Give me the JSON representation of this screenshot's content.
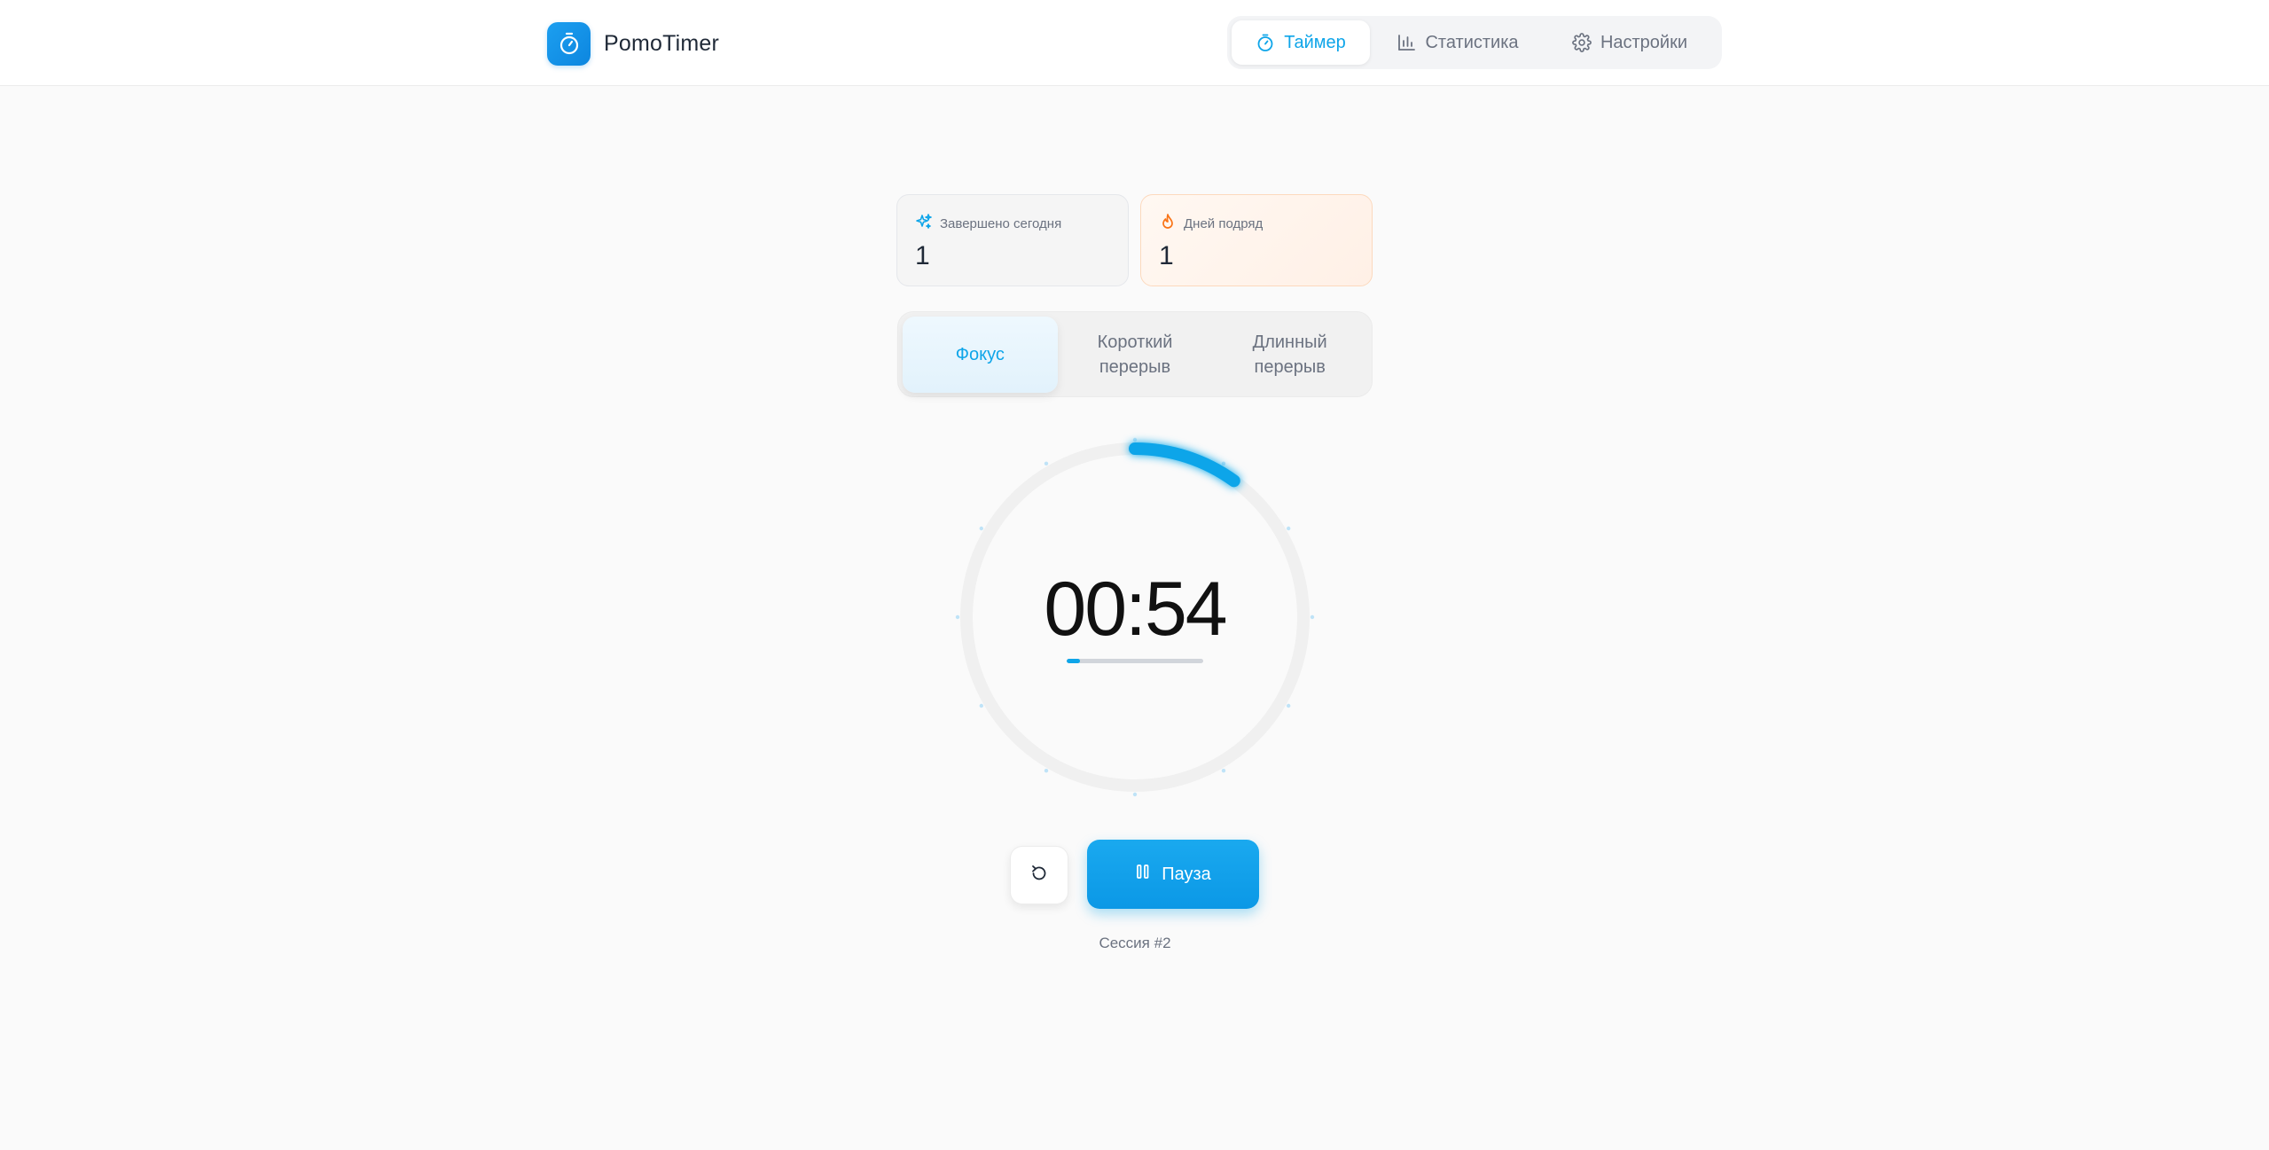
{
  "app": {
    "name": "PomoTimer",
    "logo_icon": "stopwatch-icon",
    "accent": "#0ea5e9"
  },
  "nav": {
    "items": [
      {
        "label": "Таймер",
        "icon": "stopwatch-icon",
        "active": true
      },
      {
        "label": "Статистика",
        "icon": "bar-chart-icon",
        "active": false
      },
      {
        "label": "Настройки",
        "icon": "gear-icon",
        "active": false
      }
    ]
  },
  "stats": {
    "completed": {
      "label": "Завершено сегодня",
      "value": "1",
      "icon": "sparkles-icon",
      "color": "#0ea5e9"
    },
    "streak": {
      "label": "Дней подряд",
      "value": "1",
      "icon": "flame-icon",
      "color": "#f97316"
    }
  },
  "modes": {
    "items": [
      {
        "label": "Фокус",
        "active": true
      },
      {
        "label": "Короткий перерыв",
        "active": false
      },
      {
        "label": "Длинный перерыв",
        "active": false
      }
    ]
  },
  "timer": {
    "time": "00:54",
    "progress": 0.1,
    "bar_progress": 0.1
  },
  "controls": {
    "reset_icon": "reset-icon",
    "pause_label": "Пауза",
    "pause_icon": "pause-icon"
  },
  "session": {
    "label": "Сессия #2"
  }
}
